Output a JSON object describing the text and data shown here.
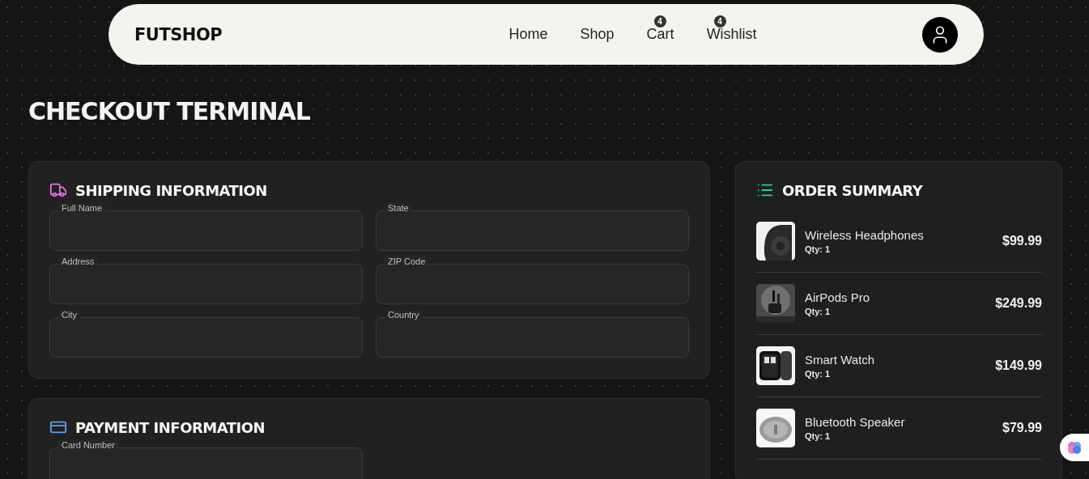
{
  "nav": {
    "logo": "FUTSHOP",
    "links": [
      {
        "label": "Home"
      },
      {
        "label": "Shop"
      },
      {
        "label": "Cart",
        "badge": "4"
      },
      {
        "label": "Wishlist",
        "badge": "4"
      }
    ]
  },
  "page_title": "CHECKOUT TERMINAL",
  "shipping": {
    "title": "SHIPPING INFORMATION",
    "fields": [
      {
        "label": "Full Name"
      },
      {
        "label": "State"
      },
      {
        "label": "Address"
      },
      {
        "label": "ZIP Code"
      },
      {
        "label": "City"
      },
      {
        "label": "Country"
      }
    ]
  },
  "payment": {
    "title": "PAYMENT INFORMATION",
    "fields": [
      {
        "label": "Card Number"
      }
    ]
  },
  "order_summary": {
    "title": "ORDER SUMMARY",
    "items": [
      {
        "name": "Wireless Headphones",
        "qty": "Qty: 1",
        "price": "$99.99",
        "kind": "headphones"
      },
      {
        "name": "AirPods Pro",
        "qty": "Qty: 1",
        "price": "$249.99",
        "kind": "earbuds"
      },
      {
        "name": "Smart Watch",
        "qty": "Qty: 1",
        "price": "$149.99",
        "kind": "watch"
      },
      {
        "name": "Bluetooth Speaker",
        "qty": "Qty: 1",
        "price": "$79.99",
        "kind": "speaker"
      }
    ]
  }
}
